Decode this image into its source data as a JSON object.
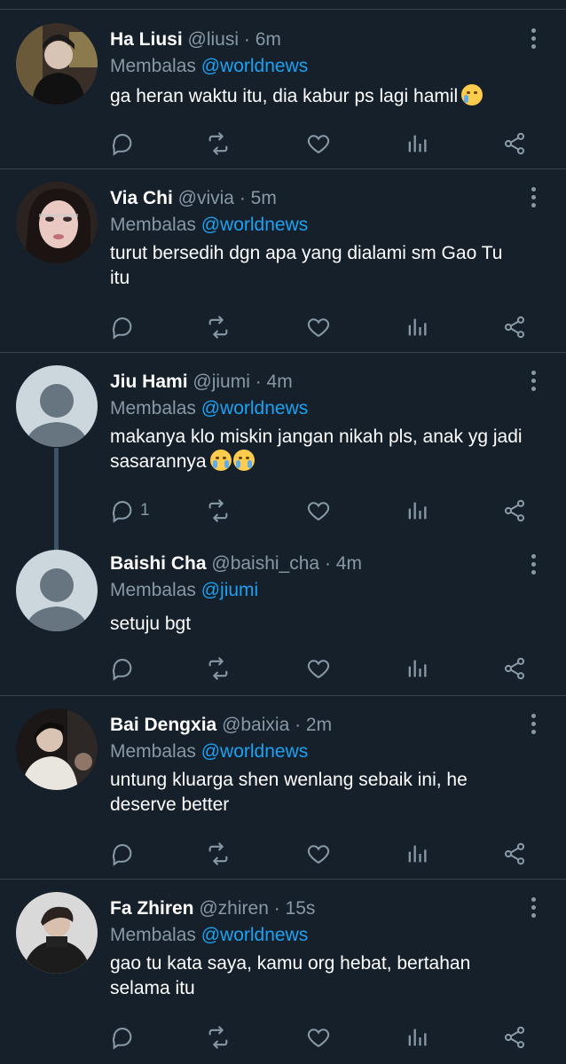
{
  "thread": {
    "tweets": [
      {
        "name": "Ha Liusi",
        "handle": "@liusi",
        "time": "6m",
        "reply_label": "Membalas",
        "mention": "@worldnews",
        "text": "ga heran waktu itu, dia kabur ps lagi hamil",
        "emoji": "crying-face",
        "reply_count": ""
      },
      {
        "name": "Via Chi",
        "handle": "@vivia",
        "time": "5m",
        "reply_label": "Membalas",
        "mention": "@worldnews",
        "text": "turut bersedih dgn apa yang dialami sm Gao Tu itu",
        "emoji": "",
        "reply_count": ""
      },
      {
        "name": "Jiu Hami",
        "handle": "@jiumi",
        "time": "4m",
        "reply_label": "Membalas",
        "mention": "@worldnews",
        "text": "makanya klo miskin jangan nikah pls, anak yg jadi sasarannya",
        "emoji": "loudly-crying-face x2",
        "reply_count": "1"
      },
      {
        "name": "Baishi Cha",
        "handle": "@baishi_cha",
        "time": "4m",
        "reply_label": "Membalas",
        "mention": "@jiumi",
        "text": "setuju bgt",
        "emoji": "",
        "reply_count": ""
      },
      {
        "name": "Bai Dengxia",
        "handle": "@baixia",
        "time": "2m",
        "reply_label": "Membalas",
        "mention": "@worldnews",
        "text": "untung kluarga shen wenlang sebaik ini, he deserve better",
        "emoji": "",
        "reply_count": ""
      },
      {
        "name": "Fa Zhiren",
        "handle": "@zhiren",
        "time": "15s",
        "reply_label": "Membalas",
        "mention": "@worldnews",
        "text": "gao tu kata saya, kamu org hebat, bertahan selama itu",
        "emoji": "",
        "reply_count": ""
      }
    ],
    "separator": " · ",
    "icons": [
      "reply-icon",
      "retweet-icon",
      "like-icon",
      "analytics-icon",
      "share-icon",
      "more-icon"
    ]
  },
  "colors": {
    "background": "#15202b",
    "divider": "#38444d",
    "muted": "#8899a6",
    "link": "#1da1f2",
    "text": "#ffffff"
  }
}
